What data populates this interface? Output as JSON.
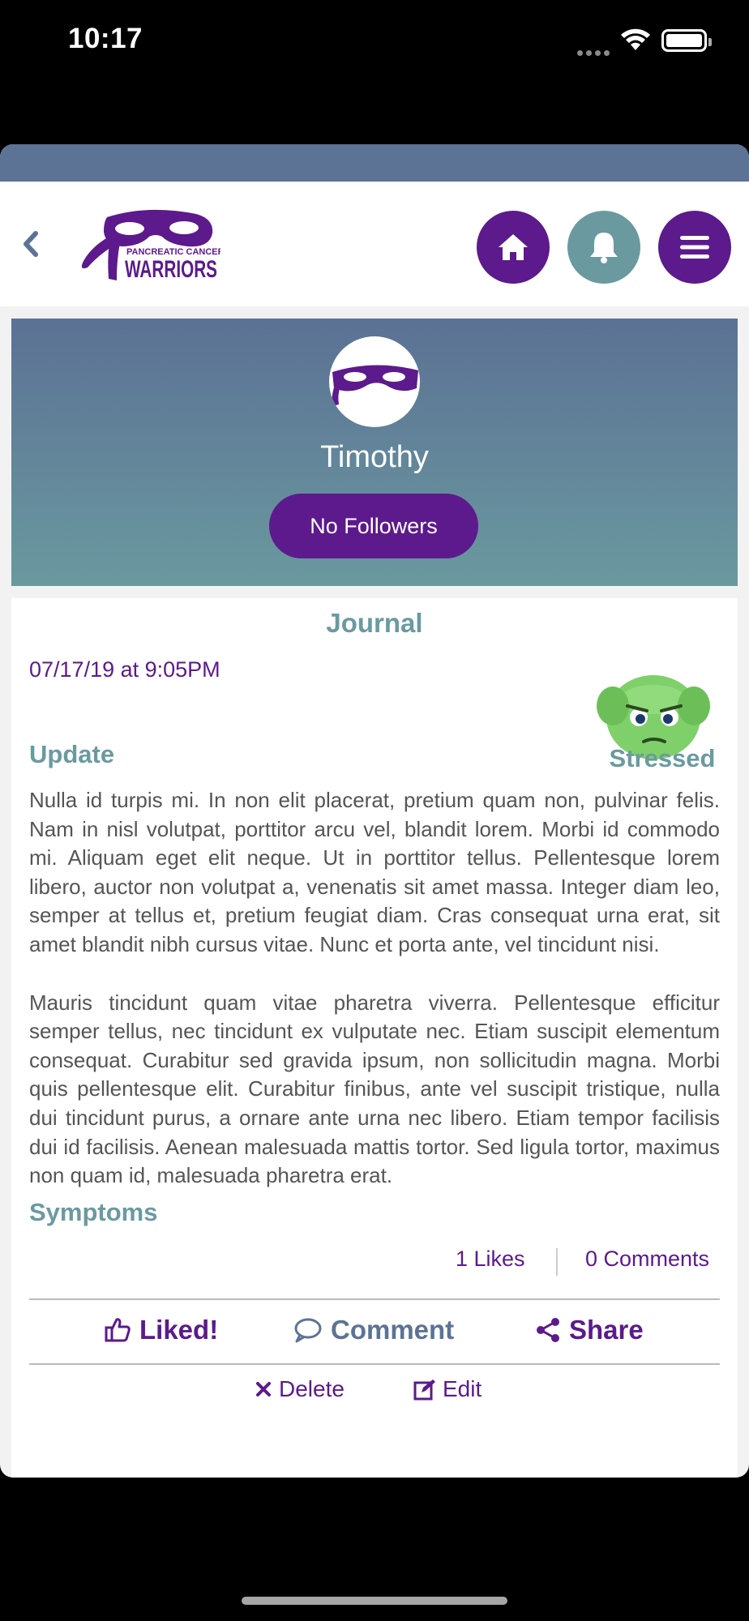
{
  "status_bar": {
    "time": "10:17"
  },
  "nav": {
    "logo_text_top": "PANCREATIC CANCER",
    "logo_text_bottom": "WARRIORS"
  },
  "profile": {
    "name": "Timothy",
    "followers_label": "No Followers"
  },
  "journal": {
    "title": "Journal",
    "date": "07/17/19 at 9:05PM",
    "mood": "Stressed",
    "update_heading": "Update",
    "paragraphs": [
      "Nulla id turpis mi. In non elit placerat, pretium quam non, pulvinar felis. Nam in nisl volutpat, porttitor arcu vel, blandit lorem. Morbi id commodo mi. Aliquam eget elit neque. Ut in porttitor tellus. Pellentesque lorem libero, auctor non volutpat a, venenatis sit amet massa. Integer diam leo, semper at tellus et, pretium feugiat diam. Cras consequat urna erat, sit amet blandit nibh cursus vitae. Nunc et porta ante, vel tincidunt nisi.",
      "Mauris tincidunt quam vitae pharetra viverra. Pellentesque efficitur semper tellus, nec tincidunt ex vulputate nec. Etiam suscipit elementum consequat. Curabitur sed gravida ipsum, non sollicitudin magna. Morbi quis pellentesque elit. Curabitur finibus, ante vel suscipit tristique, nulla dui tincidunt purus, a ornare ante urna nec libero. Etiam tempor facilisis dui id facilisis. Aenean malesuada mattis tortor. Sed ligula tortor, maximus non quam id, malesuada pharetra erat."
    ],
    "symptoms_heading": "Symptoms",
    "likes": "1 Likes",
    "comments": "0 Comments",
    "actions": {
      "like": "Liked!",
      "comment": "Comment",
      "share": "Share",
      "delete": "Delete",
      "edit": "Edit"
    }
  },
  "colors": {
    "purple": "#5c1a8c",
    "teal": "#6a9aa0",
    "slate": "#5d7395"
  }
}
